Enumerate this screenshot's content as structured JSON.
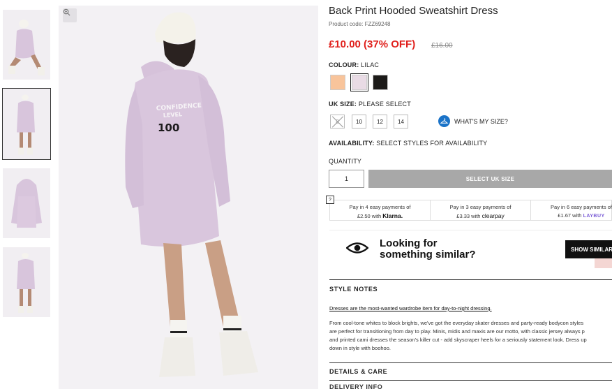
{
  "gallery": {
    "thumbnails": [
      "thumb-1",
      "thumb-2",
      "thumb-3",
      "thumb-4"
    ],
    "active_index": 1,
    "back_print": {
      "line1": "CONFIDENCE",
      "line2": "LEVEL",
      "line3": "100"
    }
  },
  "product": {
    "title": "Back Print Hooded Sweatshirt Dress",
    "code": "Product code: FZZ69248",
    "price": "£10.00 (37% OFF)",
    "was_price": "£16.00"
  },
  "colour": {
    "label": "COLOUR:",
    "selected": "LILAC",
    "swatches": [
      {
        "name": "peach",
        "hex": "#f8c49b"
      },
      {
        "name": "lilac",
        "hex": "#e9dbe5"
      },
      {
        "name": "black",
        "hex": "#1c1a18"
      }
    ]
  },
  "size": {
    "label": "UK SIZE:",
    "value": "PLEASE SELECT",
    "options": [
      "8",
      "10",
      "12",
      "14"
    ],
    "whats_my_size": "WHAT'S MY SIZE?"
  },
  "availability": {
    "label": "AVAILABILITY:",
    "value": "SELECT STYLES FOR AVAILABILITY"
  },
  "quantity": {
    "label": "QUANTITY",
    "value": "1"
  },
  "cta": {
    "select_label": "SELECT UK SIZE"
  },
  "payments": [
    {
      "line1": "Pay in 4 easy payments of",
      "amount": "£2.50 with",
      "brand": "Klarna."
    },
    {
      "line1": "Pay in 3 easy payments of",
      "amount": "£3.33 with",
      "brand": "clearpay"
    },
    {
      "line1": "Pay in 6 easy payments of",
      "amount": "£1.67 with",
      "brand": "LAYBUY"
    }
  ],
  "help_label": "?",
  "similar": {
    "line1": "Looking for",
    "line2": "something similar?",
    "button": "SHOW SIMILAR"
  },
  "style_notes": {
    "title": "STYLE NOTES",
    "link": "Dresses are the most-wanted wardrobe item for day-to-night dressing.",
    "body": [
      "From cool-tone whites to block brights, we've got the everyday skater dresses and party-ready bodycon styles",
      "are perfect for transitioning from day to play. Minis, midis and maxis are our motto, with classic jersey always p",
      "and printed cami dresses the season's killer cut - add skyscraper heels for a seriously statement look. Dress up",
      "down in style with boohoo."
    ]
  },
  "details": {
    "title": "DETAILS & CARE"
  },
  "delivery": {
    "title": "DELIVERY INFO"
  },
  "colors": {
    "sale_red": "#e0201c",
    "dark": "#111111",
    "grey_button": "#a8a8a8",
    "sweatshirt_lilac": "#d9c6dd"
  }
}
